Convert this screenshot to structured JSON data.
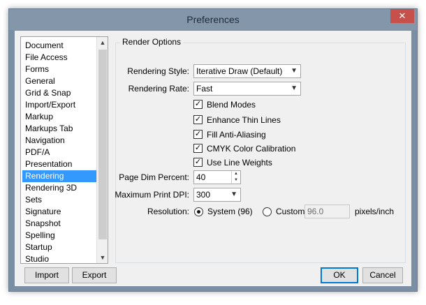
{
  "window": {
    "title": "Preferences",
    "close_glyph": "✕"
  },
  "categories": {
    "items": [
      {
        "label": "Document"
      },
      {
        "label": "File Access"
      },
      {
        "label": "Forms"
      },
      {
        "label": "General"
      },
      {
        "label": "Grid & Snap"
      },
      {
        "label": "Import/Export"
      },
      {
        "label": "Markup"
      },
      {
        "label": "Markups Tab"
      },
      {
        "label": "Navigation"
      },
      {
        "label": "PDF/A"
      },
      {
        "label": "Presentation"
      },
      {
        "label": "Rendering"
      },
      {
        "label": "Rendering 3D"
      },
      {
        "label": "Sets"
      },
      {
        "label": "Signature"
      },
      {
        "label": "Snapshot"
      },
      {
        "label": "Spelling"
      },
      {
        "label": "Startup"
      },
      {
        "label": "Studio"
      }
    ],
    "selected": "Rendering"
  },
  "render_options": {
    "group_title": "Render Options",
    "rendering_style": {
      "label": "Rendering Style:",
      "value": "Iterative Draw (Default)"
    },
    "rendering_rate": {
      "label": "Rendering Rate:",
      "value": "Fast"
    },
    "checkboxes": [
      {
        "label": "Blend Modes",
        "checked": true
      },
      {
        "label": "Enhance Thin Lines",
        "checked": true
      },
      {
        "label": "Fill Anti-Aliasing",
        "checked": true
      },
      {
        "label": "CMYK Color Calibration",
        "checked": true
      },
      {
        "label": "Use Line Weights",
        "checked": true
      }
    ],
    "page_dim_percent": {
      "label": "Page Dim Percent:",
      "value": "40"
    },
    "max_print_dpi": {
      "label": "Maximum Print DPI:",
      "value": "300"
    },
    "resolution": {
      "label": "Resolution:",
      "system_label": "System (96)",
      "custom_label": "Custom",
      "custom_value": "96.0",
      "unit": "pixels/inch",
      "selected": "system"
    }
  },
  "footer": {
    "import_label": "Import",
    "export_label": "Export",
    "ok_label": "OK",
    "cancel_label": "Cancel"
  },
  "glyphs": {
    "check": "✓",
    "up": "▲",
    "down": "▼",
    "chevron": "⌄"
  }
}
